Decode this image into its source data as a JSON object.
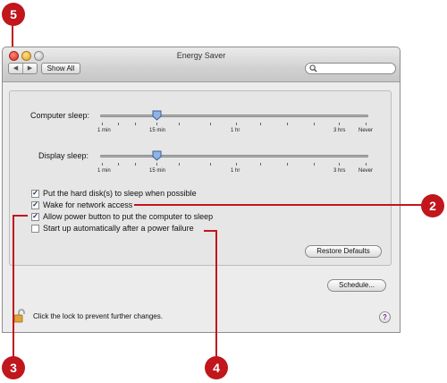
{
  "window": {
    "title": "Energy Saver"
  },
  "toolbar": {
    "back_glyph": "◀",
    "forward_glyph": "▶",
    "show_all_label": "Show All",
    "search_placeholder": ""
  },
  "sliders": [
    {
      "label": "Computer sleep:",
      "ticks": [
        "1 min",
        "15 min",
        "1 hr",
        "3 hrs",
        "Never"
      ],
      "value": "15 min"
    },
    {
      "label": "Display sleep:",
      "ticks": [
        "1 min",
        "15 min",
        "1 hr",
        "3 hrs",
        "Never"
      ],
      "value": "15 min"
    }
  ],
  "options": [
    {
      "label": "Put the hard disk(s) to sleep when possible",
      "checked": true
    },
    {
      "label": "Wake for network access",
      "checked": true
    },
    {
      "label": "Allow power button to put the computer to sleep",
      "checked": true
    },
    {
      "label": "Start up automatically after a power failure",
      "checked": false
    }
  ],
  "buttons": {
    "restore_defaults": "Restore Defaults",
    "schedule": "Schedule..."
  },
  "lock": {
    "text": "Click the lock to prevent further changes."
  },
  "help": {
    "glyph": "?"
  },
  "callouts": [
    "5",
    "2",
    "3",
    "4"
  ],
  "colors": {
    "callout": "#c0161c",
    "check": "#13235a"
  }
}
